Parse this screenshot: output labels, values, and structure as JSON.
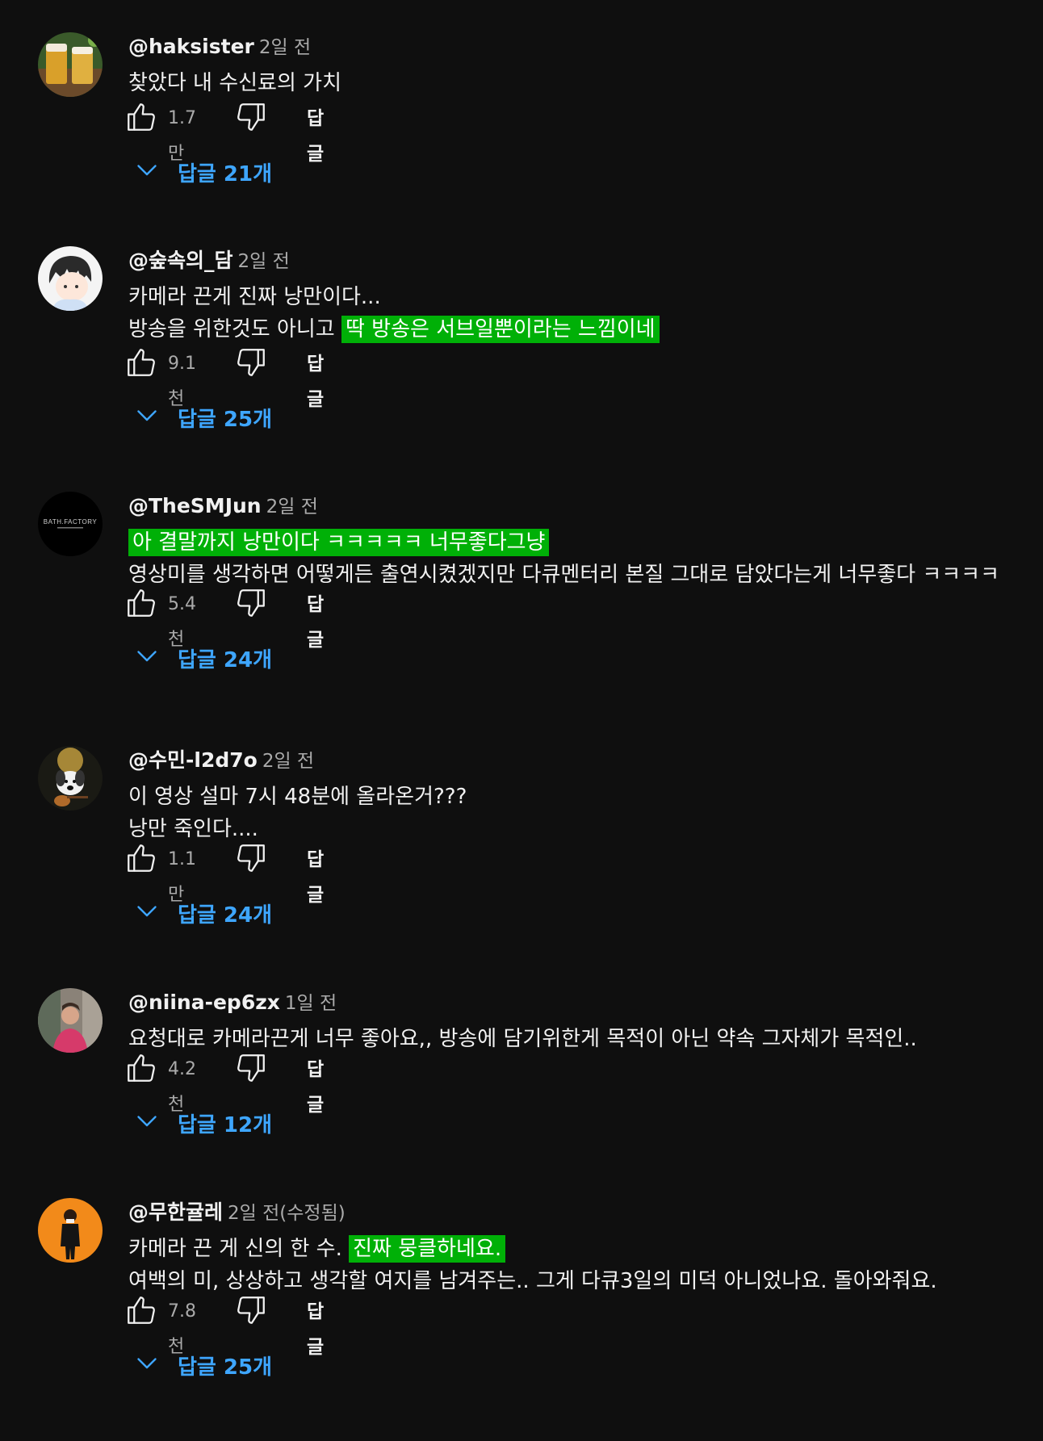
{
  "comments": [
    {
      "author": "@haksister",
      "time": "2일 전",
      "lines": [
        [
          {
            "t": "찾았다 내 수신료의 가치",
            "hl": false
          }
        ]
      ],
      "likes": "1.7만",
      "reply_label": "답글",
      "replies_label": "답글 21개",
      "avatar_icon": "beer-avatar"
    },
    {
      "author": "@숲속의_담",
      "time": "2일 전",
      "lines": [
        [
          {
            "t": "카메라 끈게 진짜 낭만이다...",
            "hl": false
          }
        ],
        [
          {
            "t": "방송을 위한것도 아니고 ",
            "hl": false
          },
          {
            "t": "딱 방송은 서브일뿐이라는 느낌이네",
            "hl": true
          }
        ]
      ],
      "likes": "9.1천",
      "reply_label": "답글",
      "replies_label": "답글 25개",
      "avatar_icon": "cartoon-boy-avatar"
    },
    {
      "author": "@TheSMJun",
      "time": "2일 전",
      "lines": [
        [
          {
            "t": "아 결말까지 낭만이다 ㅋㅋㅋㅋㅋ 너무좋다그냥",
            "hl": true
          }
        ],
        [
          {
            "t": "영상미를 생각하면 어떻게든 출연시켰겠지만 다큐멘터리 본질 그대로 담았다는게 너무좋다 ㅋㅋㅋㅋ",
            "hl": false
          }
        ]
      ],
      "likes": "5.4천",
      "reply_label": "답글",
      "replies_label": "답글 24개",
      "avatar_icon": "bath-factory-logo-avatar",
      "avatar_logo_text": "BATH.FACTORY"
    },
    {
      "author": "@수민-l2d7o",
      "time": "2일 전",
      "lines": [
        [
          {
            "t": "이 영상 설마 7시 48분에 올라온거???",
            "hl": false
          }
        ],
        [
          {
            "t": "낭만 죽인다....",
            "hl": false
          }
        ]
      ],
      "likes": "1.1만",
      "reply_label": "답글",
      "replies_label": "답글 24개",
      "avatar_icon": "dog-guitar-avatar"
    },
    {
      "author": "@niina-ep6zx",
      "time": "1일 전",
      "lines": [
        [
          {
            "t": "요청대로 카메라끈게 너무 좋아요,, 방송에 담기위한게 목적이 아닌 약속 그자체가 목적인..",
            "hl": false
          }
        ]
      ],
      "likes": "4.2천",
      "reply_label": "답글",
      "replies_label": "답글 12개",
      "avatar_icon": "person-photo-avatar"
    },
    {
      "author": "@무한귤레",
      "time": "2일 전(수정됨)",
      "lines": [
        [
          {
            "t": "카메라 끈 게 신의 한 수. ",
            "hl": false
          },
          {
            "t": "진짜 뭉클하네요.",
            "hl": true
          }
        ],
        [
          {
            "t": "여백의 미, 상상하고 생각할 여지를 남겨주는.. 그게 다큐3일의 미덕 아니었나요. 돌아와줘요.",
            "hl": false
          }
        ]
      ],
      "likes": "7.8천",
      "reply_label": "답글",
      "replies_label": "답글 25개",
      "avatar_icon": "orange-person-avatar"
    }
  ],
  "colors": {
    "background": "#0f0f0f",
    "highlight": "#00b007",
    "link": "#3ea6ff",
    "muted": "#aaaaaa"
  }
}
